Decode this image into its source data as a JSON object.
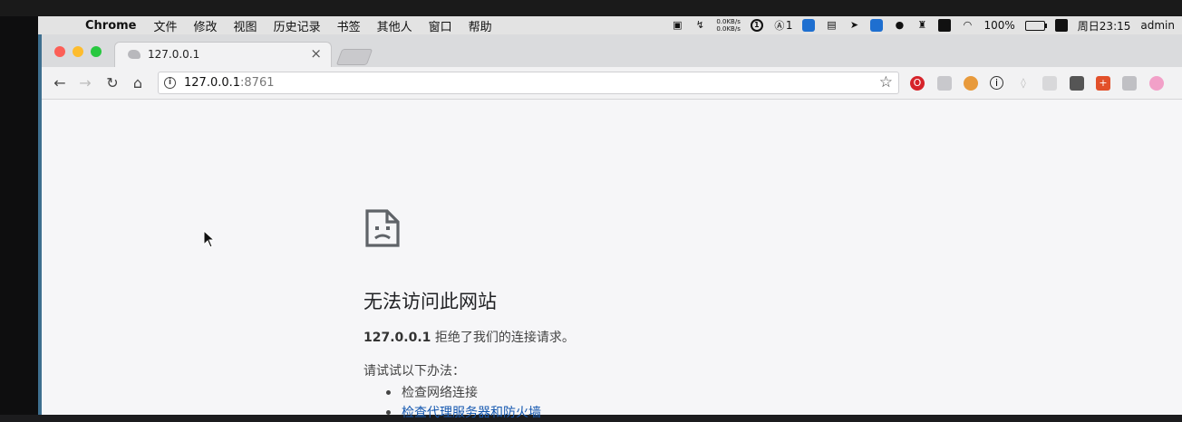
{
  "menubar": {
    "app": "Chrome",
    "items": [
      "文件",
      "修改",
      "视图",
      "历史记录",
      "书签",
      "其他人",
      "窗口",
      "帮助"
    ],
    "netspeed_up": "0.0KB/s",
    "netspeed_down": "0.0KB/s",
    "badge_count": "1",
    "battery": "100%",
    "clock": "周日23:15",
    "user": "admin"
  },
  "tab": {
    "title": "127.0.0.1",
    "close": "×"
  },
  "toolbar": {
    "url_host": "127.0.0.1",
    "url_port": ":8761"
  },
  "error": {
    "title": "无法访问此网站",
    "host": "127.0.0.1",
    "message": " 拒绝了我们的连接请求。",
    "suggest_heading": "请试试以下办法：",
    "suggestions": [
      {
        "text": "检查网络连接",
        "link": false
      },
      {
        "text": "检查代理服务器和防火墙",
        "link": true
      }
    ]
  },
  "colors": {
    "link": "#1558b0",
    "title_text": "#202124",
    "tl_red": "#fc5f57",
    "tl_yellow": "#fdbc2e",
    "tl_green": "#28c840"
  },
  "icons": [
    "apple-icon",
    "info-icon",
    "star-icon",
    "back-icon",
    "forward-icon",
    "reload-icon",
    "home-icon",
    "sad-page-icon",
    "wifi-icon",
    "battery-icon",
    "mouse-cursor"
  ]
}
